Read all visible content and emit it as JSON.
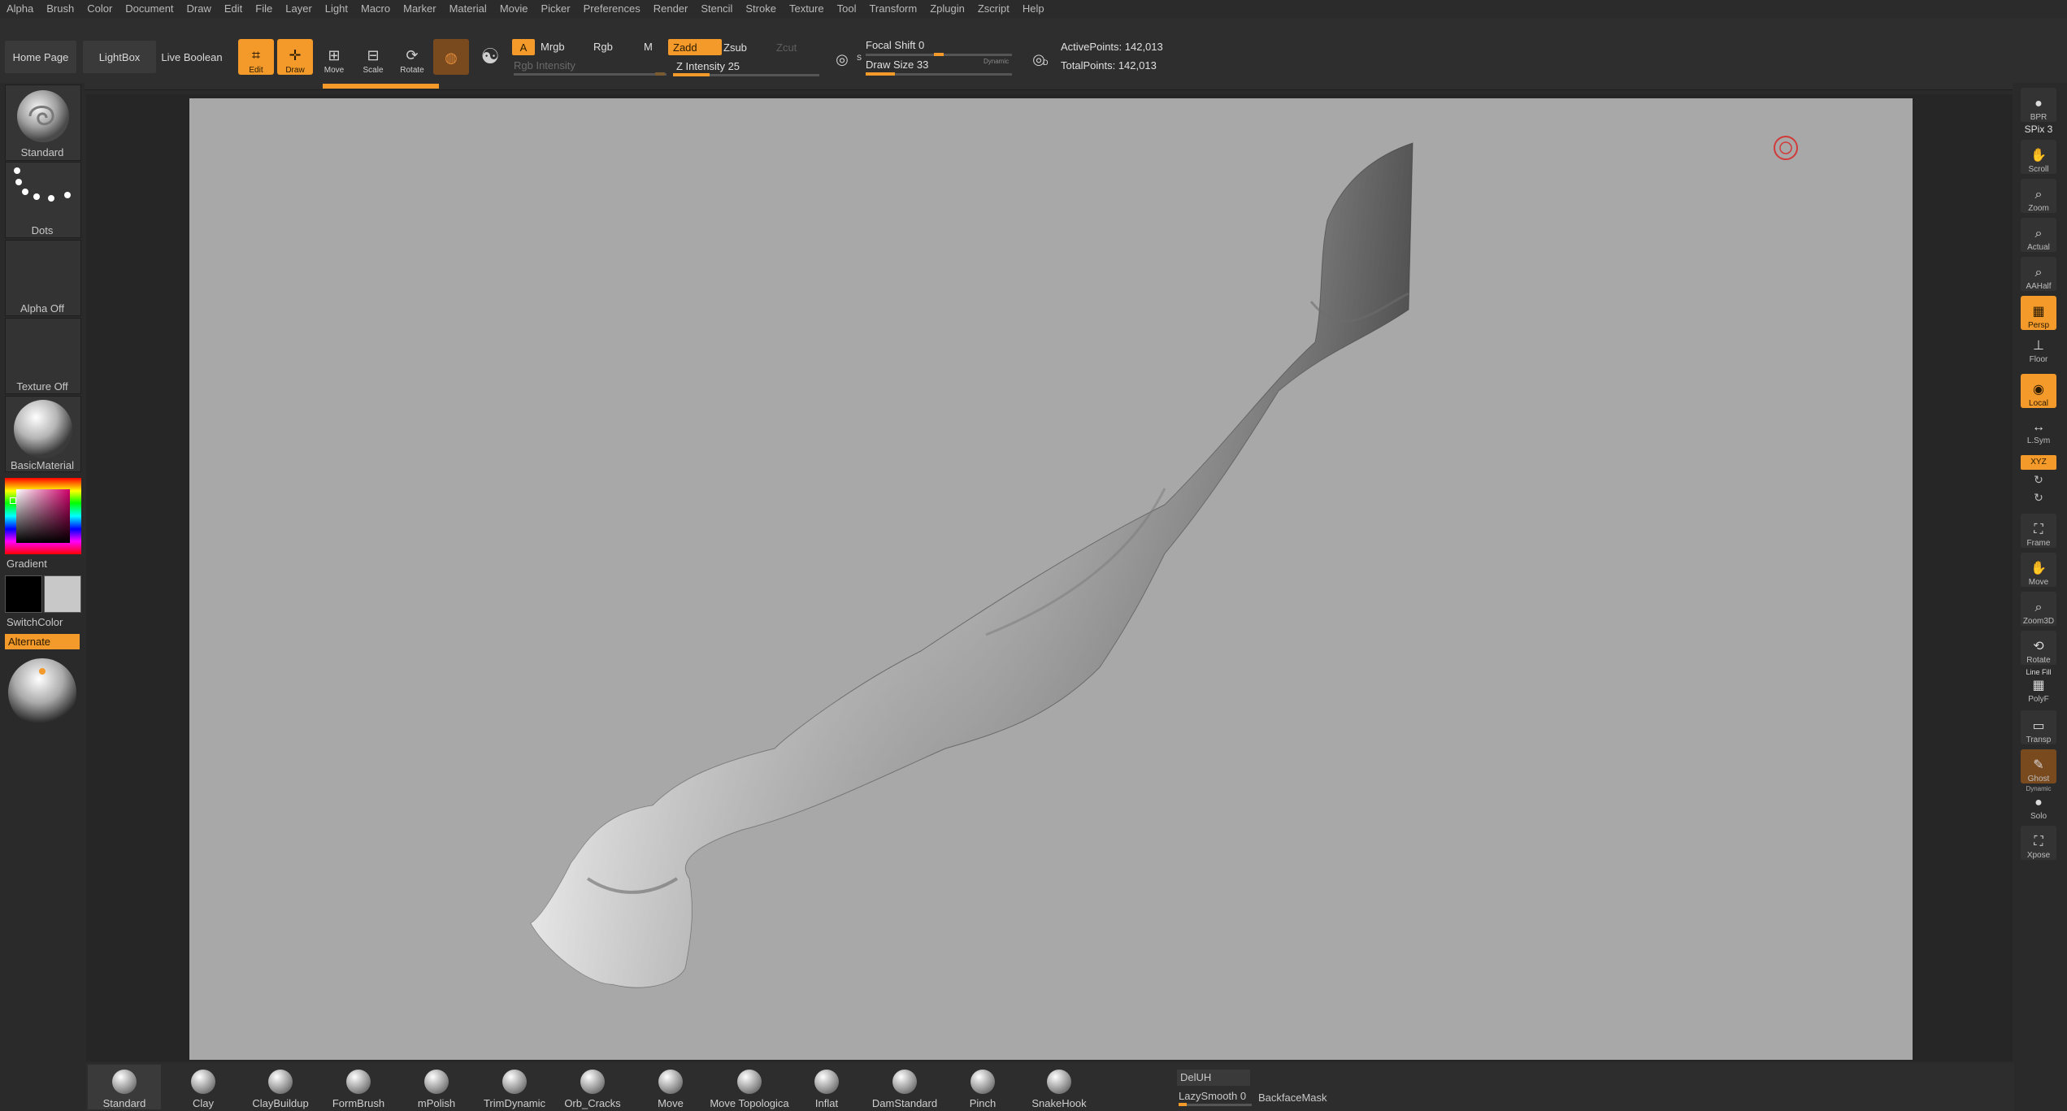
{
  "menu": [
    "Alpha",
    "Brush",
    "Color",
    "Document",
    "Draw",
    "Edit",
    "File",
    "Layer",
    "Light",
    "Macro",
    "Marker",
    "Material",
    "Movie",
    "Picker",
    "Preferences",
    "Render",
    "Stencil",
    "Stroke",
    "Texture",
    "Tool",
    "Transform",
    "Zplugin",
    "Zscript",
    "Help"
  ],
  "topbar": {
    "home_page": "Home Page",
    "lightbox": "LightBox",
    "live_boolean": "Live Boolean",
    "edit": "Edit",
    "draw": "Draw",
    "move": "Move",
    "scale": "Scale",
    "rotate": "Rotate",
    "a": "A",
    "mrgb": "Mrgb",
    "rgb": "Rgb",
    "m": "M",
    "rgb_intensity": "Rgb Intensity",
    "zadd": "Zadd",
    "zsub": "Zsub",
    "zcut": "Zcut",
    "z_intensity": "Z Intensity 25",
    "focal_shift": "Focal Shift 0",
    "draw_size": "Draw Size 33",
    "dynamic": "Dynamic",
    "active_points": "ActivePoints: 142,013",
    "total_points": "TotalPoints: 142,013",
    "s_icon_label": "S",
    "d_icon_label": "D"
  },
  "levels": {
    "z_intensity": 0.25,
    "focal_shift": 0.5,
    "draw_size": 0.2
  },
  "left": {
    "brush": "Standard",
    "stroke": "Dots",
    "alpha": "Alpha Off",
    "texture": "Texture Off",
    "material": "BasicMaterial",
    "gradient": "Gradient",
    "switchcolor": "SwitchColor",
    "alternate": "Alternate"
  },
  "right": [
    {
      "label": "BPR",
      "icon": "render-icon"
    },
    {
      "label": "SPix 3",
      "icon": "spix-slider"
    },
    {
      "label": "Scroll",
      "icon": "scroll-icon"
    },
    {
      "label": "Zoom",
      "icon": "zoom-icon"
    },
    {
      "label": "Actual",
      "icon": "actual-icon"
    },
    {
      "label": "AAHalf",
      "icon": "aahalf-icon"
    },
    {
      "label": "Persp",
      "icon": "persp-icon"
    },
    {
      "label": "Floor",
      "icon": "floor-icon"
    },
    {
      "label": "Local",
      "icon": "local-icon"
    },
    {
      "label": "L.Sym",
      "icon": "lsym-icon"
    },
    {
      "label": "XYZ",
      "icon": "xyz-icon"
    },
    {
      "label": "Frame",
      "icon": "frame-icon"
    },
    {
      "label": "Move",
      "icon": "move-icon"
    },
    {
      "label": "Zoom3D",
      "icon": "zoom3d-icon"
    },
    {
      "label": "Rotate",
      "icon": "rotate-icon"
    },
    {
      "label": "Line Fill",
      "icon": "linefill-icon"
    },
    {
      "label": "PolyF",
      "icon": "polyf-icon"
    },
    {
      "label": "Transp",
      "icon": "transp-icon"
    },
    {
      "label": "Ghost",
      "icon": "ghost-icon"
    },
    {
      "label": "Dynamic",
      "icon": "dynamic-icon"
    },
    {
      "label": "Solo",
      "icon": "solo-icon"
    },
    {
      "label": "Xpose",
      "icon": "xpose-icon"
    }
  ],
  "bottom": {
    "brushes": [
      "Standard",
      "Clay",
      "ClayBuildup",
      "FormBrush",
      "mPolish",
      "TrimDynamic",
      "Orb_Cracks",
      "Move",
      "Move Topologica",
      "Inflat",
      "DamStandard",
      "Pinch",
      "SnakeHook"
    ],
    "deluh": "DelUH",
    "lazysmooth": "LazySmooth 0",
    "backfacemask": "BackfaceMask"
  },
  "colors": {
    "accent": "#f39a2a",
    "canvas": "#a8a8a8",
    "panel": "#2a2a2a"
  }
}
